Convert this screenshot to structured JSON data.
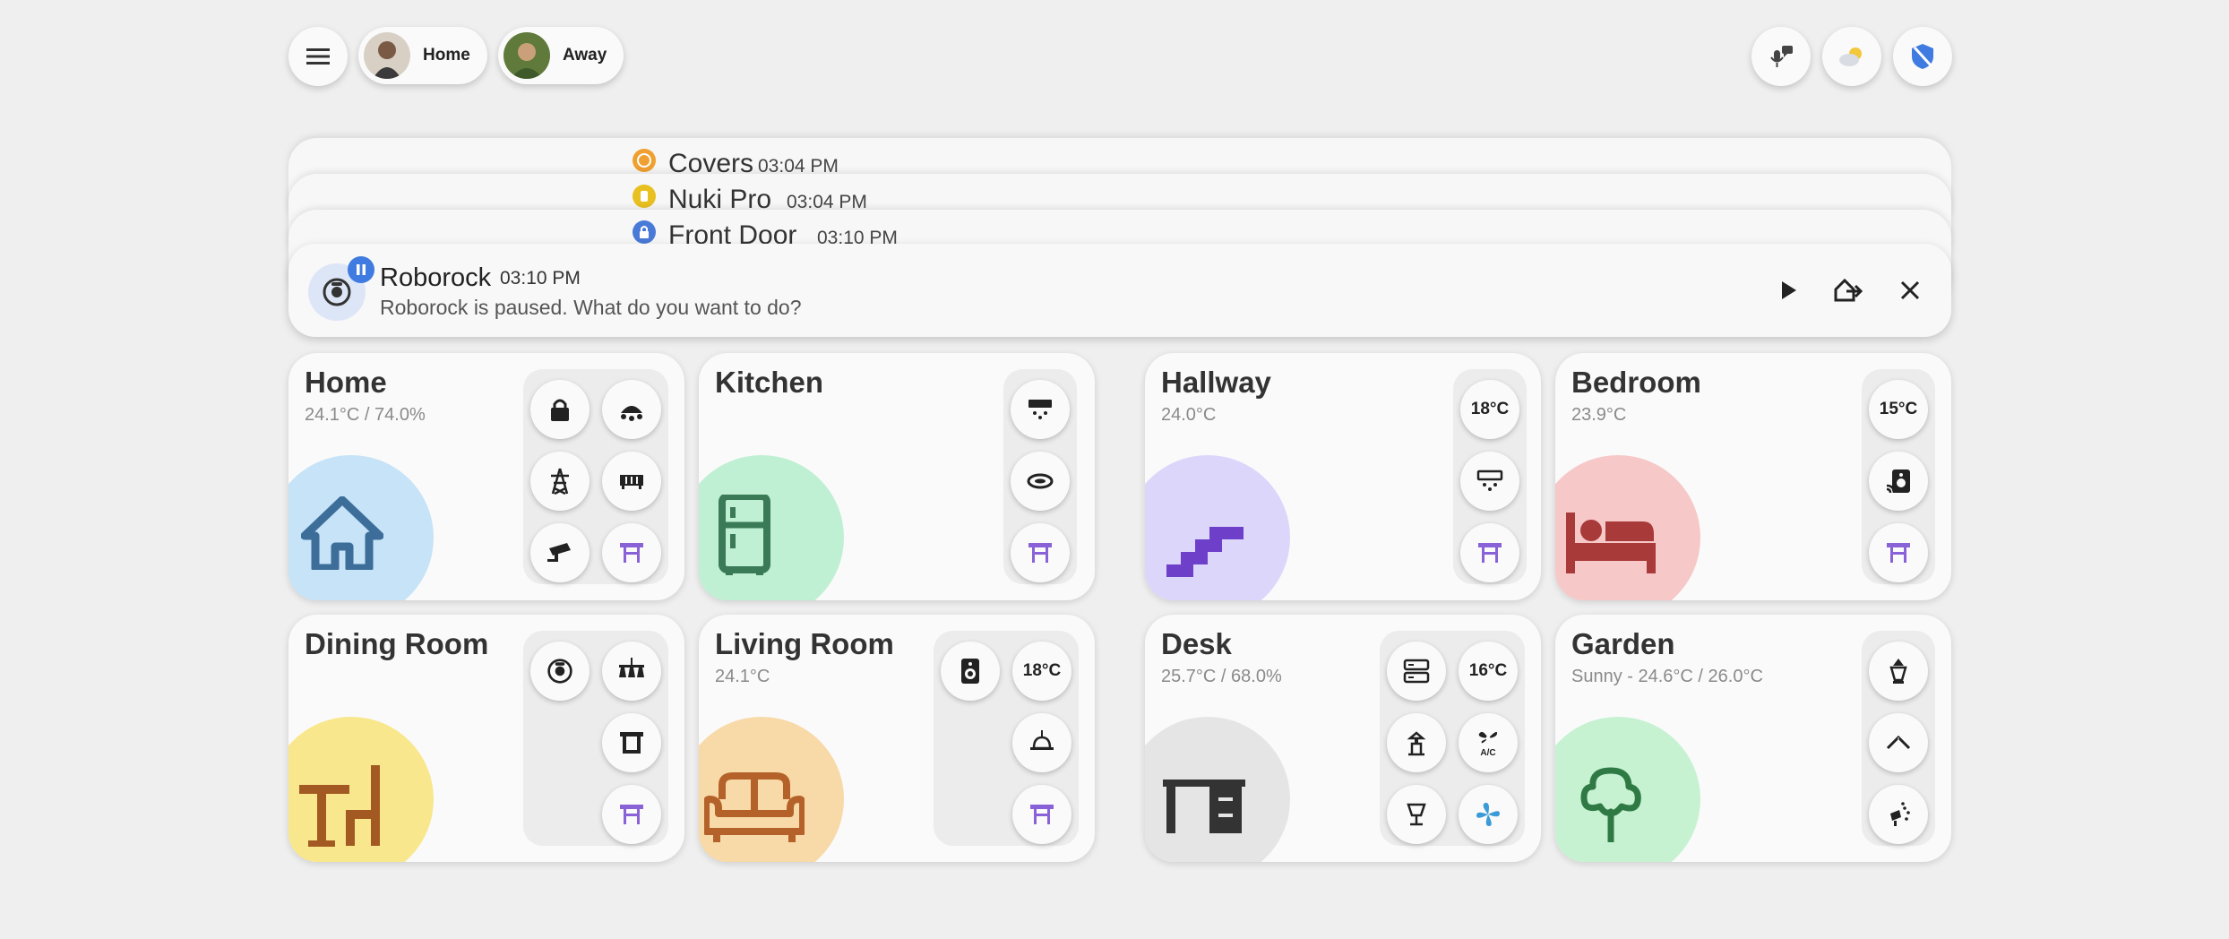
{
  "header": {
    "menu_icon": "menu-icon",
    "persons": [
      {
        "label": "Home"
      },
      {
        "label": "Away"
      }
    ],
    "actions": [
      "voice-assistant-icon",
      "weather-icon",
      "security-shield-icon"
    ]
  },
  "notifications": {
    "stacked": [
      {
        "title": "Covers",
        "time": "03:04 PM",
        "badge_color": "#f0a030"
      },
      {
        "title": "Nuki Pro",
        "time": "03:04 PM",
        "badge_color": "#e8c020"
      },
      {
        "title": "Front Door",
        "time": "03:10 PM",
        "badge_color": "#4a7ad8"
      }
    ],
    "active": {
      "title": "Roborock",
      "time": "03:10 PM",
      "message": "Roborock is paused. What do you want to do?",
      "badge_color": "#3f7be0",
      "actions": [
        "play-icon",
        "return-home-icon",
        "close-icon"
      ]
    }
  },
  "rooms": [
    {
      "name": "Home",
      "subtitle": "24.1°C / 74.0%",
      "color": "#c6e3f7",
      "icon": "house-icon"
    },
    {
      "name": "Kitchen",
      "subtitle": "",
      "color": "#bff0d3",
      "icon": "fridge-icon"
    },
    {
      "name": "Hallway",
      "subtitle": "24.0°C",
      "color": "#dcd6fb",
      "icon": "stairs-icon",
      "temp": "18°C"
    },
    {
      "name": "Bedroom",
      "subtitle": "23.9°C",
      "color": "#f7c8c8",
      "icon": "bed-icon",
      "temp": "15°C"
    },
    {
      "name": "Dining Room",
      "subtitle": "",
      "color": "#f9e78e",
      "icon": "table-chair-icon"
    },
    {
      "name": "Living Room",
      "subtitle": "24.1°C",
      "color": "#f8d9a8",
      "icon": "sofa-icon",
      "temp": "18°C"
    },
    {
      "name": "Desk",
      "subtitle": "25.7°C / 68.0%",
      "color": "#e5e5e5",
      "icon": "desk-icon",
      "temp": "16°C"
    },
    {
      "name": "Garden",
      "subtitle": "Sunny - 24.6°C / 26.0°C",
      "color": "#c6f2d2",
      "icon": "tree-icon"
    }
  ],
  "colors": {
    "accent_purple": "#8a62d8",
    "background": "#efefef",
    "card": "#fafafa"
  }
}
